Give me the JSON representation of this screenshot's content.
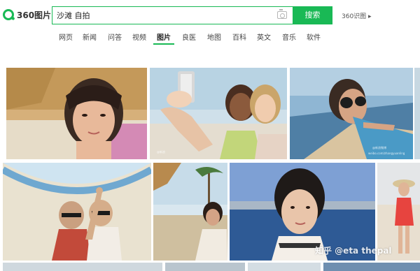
{
  "header": {
    "logo_text": "360图片",
    "search_value": "沙滩 自拍",
    "search_button": "搜索",
    "site_link": "360识图 ▸"
  },
  "nav": {
    "items": [
      "网页",
      "新闻",
      "问答",
      "视频",
      "图片",
      "良医",
      "地图",
      "百科",
      "英文",
      "音乐",
      "软件"
    ],
    "active": "图片"
  },
  "watermarks": {
    "zhihu": "知乎 @eta thepal",
    "weibo": "@新浪微博",
    "weibo_url": "weibo.com/zhangyuanling",
    "source": "WorldBeach"
  },
  "colors": {
    "accent": "#19b955"
  }
}
